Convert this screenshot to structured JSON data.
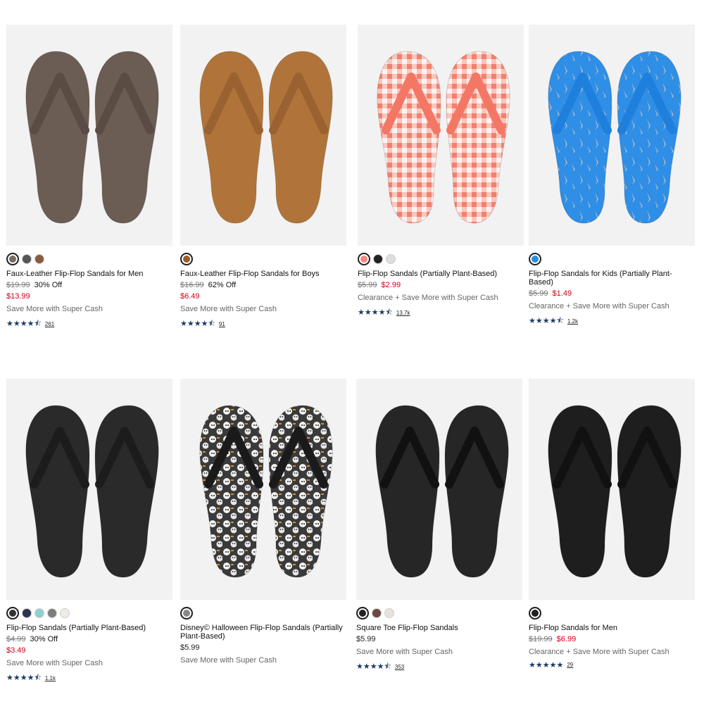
{
  "products": [
    {
      "name": "Faux-Leather Flip-Flop Sandals for Men",
      "was": "$19.99",
      "off": "30% Off",
      "now": "$13.99",
      "now_on_row": false,
      "promo": "Save More with Super Cash",
      "rating": 4.5,
      "reviews": "261",
      "swatches": [
        "#7a6a60",
        "#555555",
        "#8a5a3c"
      ],
      "sole_color": "#6b5d54",
      "strap_color": "#5a4c44",
      "pattern": "none"
    },
    {
      "name": "Faux-Leather Flip-Flop Sandals for Boys",
      "was": "$16.99",
      "off": "62% Off",
      "now": "$6.49",
      "now_on_row": false,
      "promo": "Save More with Super Cash",
      "rating": 4.5,
      "reviews": "91",
      "swatches": [
        "#9a5a2a"
      ],
      "sole_color": "#b0743a",
      "strap_color": "#9a6230",
      "pattern": "none"
    },
    {
      "name": "Flip-Flop Sandals (Partially Plant-Based)",
      "was": "$5.99",
      "off": "",
      "now": "$2.99",
      "now_on_row": true,
      "promo": "Clearance + Save More with Super Cash",
      "rating": 4.5,
      "reviews": "13.7k",
      "swatches": [
        "#f08a80",
        "#222222",
        "#dddddd"
      ],
      "sole_color": "#fbe4df",
      "strap_color": "#f47765",
      "pattern": "gingham"
    },
    {
      "name": "Flip-Flop Sandals for Kids (Partially Plant-Based)",
      "was": "$5.99",
      "off": "",
      "now": "$1.49",
      "now_on_row": true,
      "promo": "Clearance + Save More with Super Cash",
      "rating": 4.5,
      "reviews": "1.2k",
      "swatches": [
        "#2a8ee0"
      ],
      "sole_color": "#2f8ee6",
      "strap_color": "#1f7fdc",
      "pattern": "sharks"
    },
    {
      "name": "Flip-Flop Sandals (Partially Plant-Based)",
      "was": "$4.99",
      "off": "30% Off",
      "now": "$3.49",
      "now_on_row": false,
      "promo": "Save More with Super Cash",
      "rating": 4.5,
      "reviews": "1.1k",
      "swatches": [
        "#333333",
        "#2b3550",
        "#8fd0cf",
        "#7d7d7d",
        "#f0ece4"
      ],
      "sole_color": "#2a2a2a",
      "strap_color": "#1c1c1c",
      "pattern": "none"
    },
    {
      "name": "Disney© Halloween Flip-Flop Sandals (Partially Plant-Based)",
      "was": "",
      "off": "",
      "now": "$5.99",
      "now_on_row": false,
      "promo": "Save More with Super Cash",
      "rating": 0,
      "reviews": "",
      "swatches": [
        "#888888"
      ],
      "sole_color": "#4a4a4a",
      "strap_color": "#1a1a1a",
      "pattern": "skulls"
    },
    {
      "name": "Square Toe Flip-Flop Sandals",
      "was": "",
      "off": "",
      "now": "$5.99",
      "now_on_row": false,
      "promo": "Save More with Super Cash",
      "rating": 4.5,
      "reviews": "353",
      "swatches": [
        "#222222",
        "#6a4a40",
        "#e8e4d8"
      ],
      "sole_color": "#262626",
      "strap_color": "#111111",
      "pattern": "none"
    },
    {
      "name": "Flip-Flop Sandals for Men",
      "was": "$19.99",
      "off": "",
      "now": "$6.99",
      "now_on_row": true,
      "promo": "Clearance + Save More with Super Cash",
      "rating": 5,
      "reviews": "29",
      "swatches": [
        "#222222"
      ],
      "sole_color": "#1e1e1e",
      "strap_color": "#111111",
      "pattern": "none"
    }
  ]
}
